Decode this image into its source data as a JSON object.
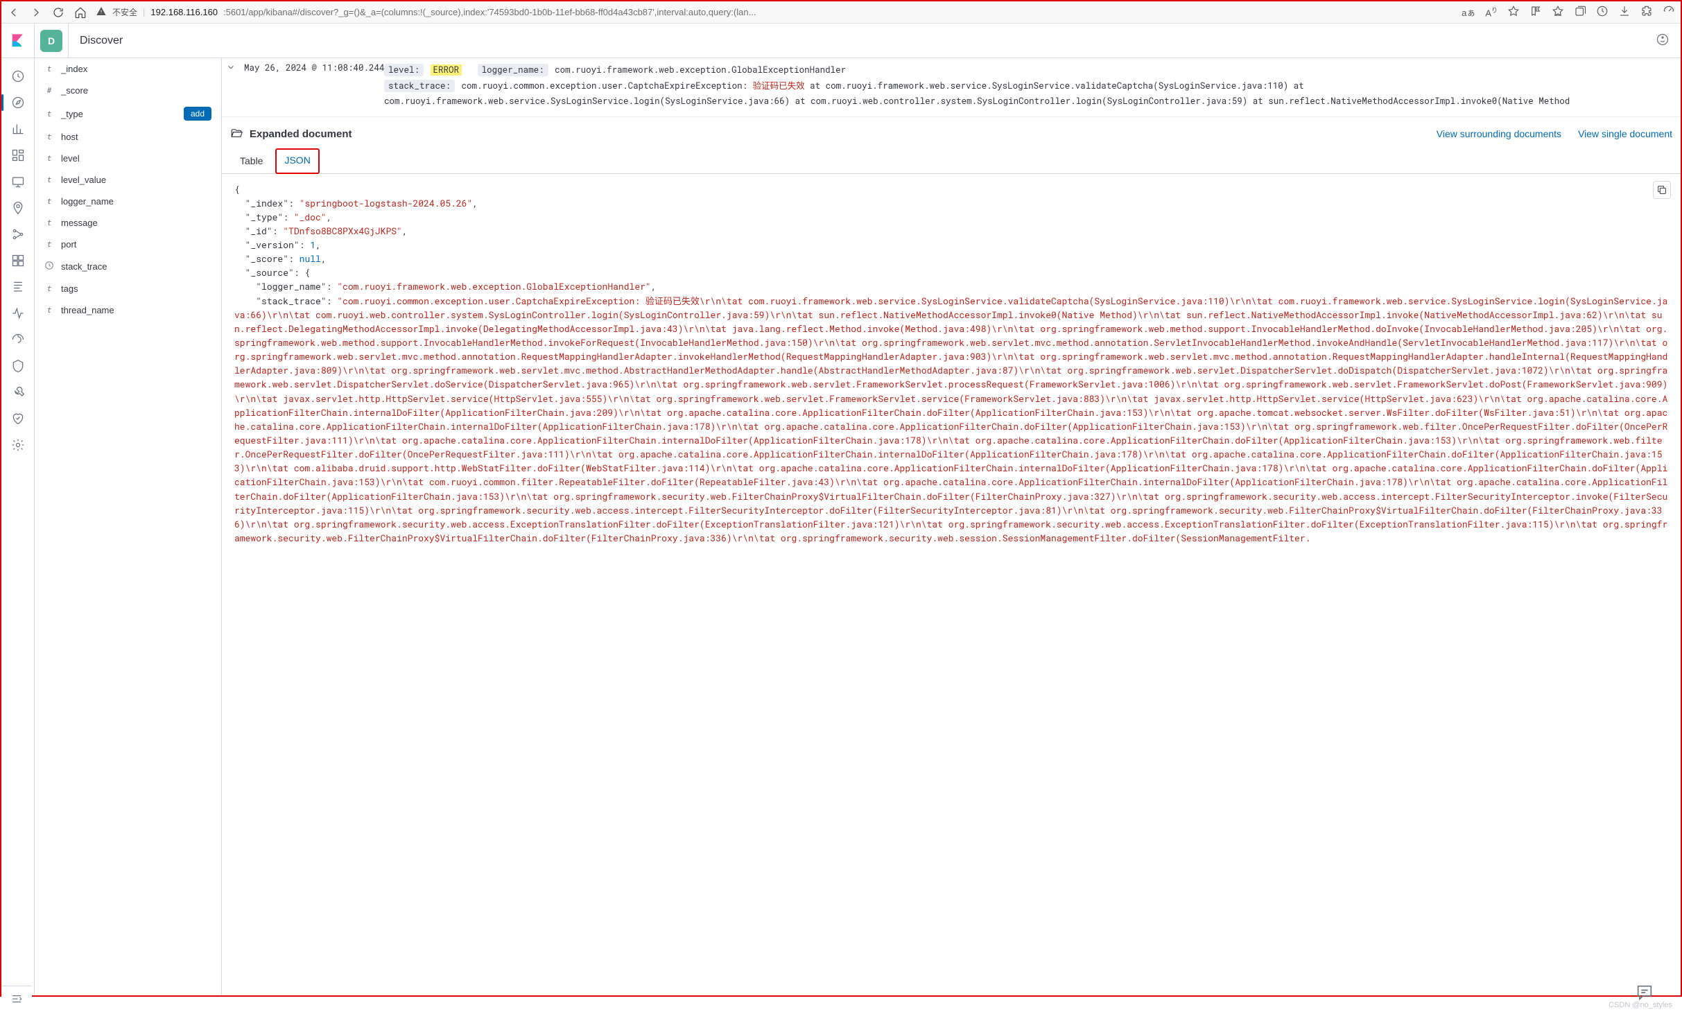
{
  "browser": {
    "insecure_text": "不安全",
    "url_host": "192.168.116.160",
    "url_path": ":5601/app/kibana#/discover?_g=()&_a=(columns:!(_source),index:'74593bd0-1b0b-11ef-bb68-ff0d4a43cb87',interval:auto,query:(lan...",
    "reader_glyph": "aぁ"
  },
  "header": {
    "space_initial": "D",
    "breadcrumb": "Discover"
  },
  "fields": [
    {
      "type": "t",
      "name": "_index"
    },
    {
      "type": "#",
      "name": "_score"
    },
    {
      "type": "t",
      "name": "_type",
      "hovered": true,
      "add_label": "add"
    },
    {
      "type": "t",
      "name": "host"
    },
    {
      "type": "t",
      "name": "level"
    },
    {
      "type": "t",
      "name": "level_value"
    },
    {
      "type": "t",
      "name": "logger_name"
    },
    {
      "type": "t",
      "name": "message"
    },
    {
      "type": "t",
      "name": "port"
    },
    {
      "type": "clock",
      "name": "stack_trace"
    },
    {
      "type": "t",
      "name": "tags"
    },
    {
      "type": "t",
      "name": "thread_name"
    }
  ],
  "doc": {
    "timestamp": "May 26, 2024 @ 11:08:40.244",
    "level_label": "level:",
    "level_value": "ERROR",
    "logger_label": "logger_name:",
    "logger_value": "com.ruoyi.framework.web.exception.GlobalExceptionHandler",
    "stack_label": "stack_trace:",
    "stack_value_pre": "com.ruoyi.common.exception.user.CaptchaExpireException: ",
    "stack_value_warn": "验证码已失效",
    "stack_value_post": " at com.ruoyi.framework.web.service.SysLoginService.validateCaptcha(SysLoginService.java:110)  at com.ruoyi.framework.web.service.SysLoginService.login(SysLoginService.java:66)  at com.ruoyi.web.controller.system.SysLoginController.login(SysLoginController.java:59)  at sun.reflect.NativeMethodAccessorImpl.invoke0(Native Method"
  },
  "expanded": {
    "title": "Expanded document",
    "link_surrounding": "View surrounding documents",
    "link_single": "View single document",
    "tab_table": "Table",
    "tab_json": "JSON"
  },
  "json": {
    "index_k": "\"_index\"",
    "index_v": "\"springboot-logstash-2024.05.26\"",
    "type_k": "\"_type\"",
    "type_v": "\"_doc\"",
    "id_k": "\"_id\"",
    "id_v": "\"TDnfso8BC8PXx4GjJKPS\"",
    "version_k": "\"_version\"",
    "version_v": "1",
    "score_k": "\"_score\"",
    "score_v": "null",
    "source_k": "\"_source\"",
    "logger_k": "\"logger_name\"",
    "logger_v": "\"com.ruoyi.framework.web.exception.GlobalExceptionHandler\"",
    "stack_k": "\"stack_trace\"",
    "stack_v": "\"com.ruoyi.common.exception.user.CaptchaExpireException: 验证码已失效\\r\\n\\tat com.ruoyi.framework.web.service.SysLoginService.validateCaptcha(SysLoginService.java:110)\\r\\n\\tat com.ruoyi.framework.web.service.SysLoginService.login(SysLoginService.java:66)\\r\\n\\tat com.ruoyi.web.controller.system.SysLoginController.login(SysLoginController.java:59)\\r\\n\\tat sun.reflect.NativeMethodAccessorImpl.invoke0(Native Method)\\r\\n\\tat sun.reflect.NativeMethodAccessorImpl.invoke(NativeMethodAccessorImpl.java:62)\\r\\n\\tat sun.reflect.DelegatingMethodAccessorImpl.invoke(DelegatingMethodAccessorImpl.java:43)\\r\\n\\tat java.lang.reflect.Method.invoke(Method.java:498)\\r\\n\\tat org.springframework.web.method.support.InvocableHandlerMethod.doInvoke(InvocableHandlerMethod.java:205)\\r\\n\\tat org.springframework.web.method.support.InvocableHandlerMethod.invokeForRequest(InvocableHandlerMethod.java:150)\\r\\n\\tat org.springframework.web.servlet.mvc.method.annotation.ServletInvocableHandlerMethod.invokeAndHandle(ServletInvocableHandlerMethod.java:117)\\r\\n\\tat org.springframework.web.servlet.mvc.method.annotation.RequestMappingHandlerAdapter.invokeHandlerMethod(RequestMappingHandlerAdapter.java:903)\\r\\n\\tat org.springframework.web.servlet.mvc.method.annotation.RequestMappingHandlerAdapter.handleInternal(RequestMappingHandlerAdapter.java:809)\\r\\n\\tat org.springframework.web.servlet.mvc.method.AbstractHandlerMethodAdapter.handle(AbstractHandlerMethodAdapter.java:87)\\r\\n\\tat org.springframework.web.servlet.DispatcherServlet.doDispatch(DispatcherServlet.java:1072)\\r\\n\\tat org.springframework.web.servlet.DispatcherServlet.doService(DispatcherServlet.java:965)\\r\\n\\tat org.springframework.web.servlet.FrameworkServlet.processRequest(FrameworkServlet.java:1006)\\r\\n\\tat org.springframework.web.servlet.FrameworkServlet.doPost(FrameworkServlet.java:909)\\r\\n\\tat javax.servlet.http.HttpServlet.service(HttpServlet.java:555)\\r\\n\\tat org.springframework.web.servlet.FrameworkServlet.service(FrameworkServlet.java:883)\\r\\n\\tat javax.servlet.http.HttpServlet.service(HttpServlet.java:623)\\r\\n\\tat org.apache.catalina.core.ApplicationFilterChain.internalDoFilter(ApplicationFilterChain.java:209)\\r\\n\\tat org.apache.catalina.core.ApplicationFilterChain.doFilter(ApplicationFilterChain.java:153)\\r\\n\\tat org.apache.tomcat.websocket.server.WsFilter.doFilter(WsFilter.java:51)\\r\\n\\tat org.apache.catalina.core.ApplicationFilterChain.internalDoFilter(ApplicationFilterChain.java:178)\\r\\n\\tat org.apache.catalina.core.ApplicationFilterChain.doFilter(ApplicationFilterChain.java:153)\\r\\n\\tat org.springframework.web.filter.OncePerRequestFilter.doFilter(OncePerRequestFilter.java:111)\\r\\n\\tat org.apache.catalina.core.ApplicationFilterChain.internalDoFilter(ApplicationFilterChain.java:178)\\r\\n\\tat org.apache.catalina.core.ApplicationFilterChain.doFilter(ApplicationFilterChain.java:153)\\r\\n\\tat org.springframework.web.filter.OncePerRequestFilter.doFilter(OncePerRequestFilter.java:111)\\r\\n\\tat org.apache.catalina.core.ApplicationFilterChain.internalDoFilter(ApplicationFilterChain.java:178)\\r\\n\\tat org.apache.catalina.core.ApplicationFilterChain.doFilter(ApplicationFilterChain.java:153)\\r\\n\\tat com.alibaba.druid.support.http.WebStatFilter.doFilter(WebStatFilter.java:114)\\r\\n\\tat org.apache.catalina.core.ApplicationFilterChain.internalDoFilter(ApplicationFilterChain.java:178)\\r\\n\\tat org.apache.catalina.core.ApplicationFilterChain.doFilter(ApplicationFilterChain.java:153)\\r\\n\\tat com.ruoyi.common.filter.RepeatableFilter.doFilter(RepeatableFilter.java:43)\\r\\n\\tat org.apache.catalina.core.ApplicationFilterChain.internalDoFilter(ApplicationFilterChain.java:178)\\r\\n\\tat org.apache.catalina.core.ApplicationFilterChain.doFilter(ApplicationFilterChain.java:153)\\r\\n\\tat org.springframework.security.web.FilterChainProxy$VirtualFilterChain.doFilter(FilterChainProxy.java:327)\\r\\n\\tat org.springframework.security.web.access.intercept.FilterSecurityInterceptor.invoke(FilterSecurityInterceptor.java:115)\\r\\n\\tat org.springframework.security.web.access.intercept.FilterSecurityInterceptor.doFilter(FilterSecurityInterceptor.java:81)\\r\\n\\tat org.springframework.security.web.FilterChainProxy$VirtualFilterChain.doFilter(FilterChainProxy.java:336)\\r\\n\\tat org.springframework.security.web.access.ExceptionTranslationFilter.doFilter(ExceptionTranslationFilter.java:121)\\r\\n\\tat org.springframework.security.web.access.ExceptionTranslationFilter.doFilter(ExceptionTranslationFilter.java:115)\\r\\n\\tat org.springframework.security.web.FilterChainProxy$VirtualFilterChain.doFilter(FilterChainProxy.java:336)\\r\\n\\tat org.springframework.security.web.session.SessionManagementFilter.doFilter(SessionManagementFilter."
  },
  "watermark": "CSDN @no_styles"
}
